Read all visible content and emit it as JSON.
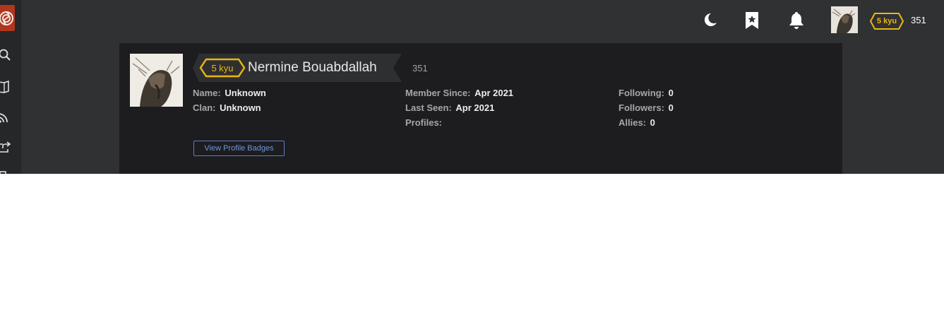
{
  "sidebar": {
    "logo_icon": "codewars-logo-icon",
    "items": [
      {
        "icon": "search-icon"
      },
      {
        "icon": "book-icon"
      },
      {
        "icon": "rss-icon"
      },
      {
        "icon": "share-icon"
      }
    ]
  },
  "topbar": {
    "theme_icon": "moon-icon",
    "bookmark_icon": "bookmark-star-icon",
    "notifications_icon": "bell-icon",
    "rank": "5 kyu",
    "honor": "351"
  },
  "profile": {
    "rank": "5 kyu",
    "username": "Nermine Bouabdallah",
    "honor": "351",
    "stats": {
      "col1": [
        {
          "label": "Name:",
          "value": "Unknown"
        },
        {
          "label": "Clan:",
          "value": "Unknown"
        }
      ],
      "col2": [
        {
          "label": "Member Since:",
          "value": "Apr 2021"
        },
        {
          "label": "Last Seen:",
          "value": "Apr 2021"
        },
        {
          "label": "Profiles:",
          "value": ""
        }
      ],
      "col3": [
        {
          "label": "Following:",
          "value": "0"
        },
        {
          "label": "Followers:",
          "value": "0"
        },
        {
          "label": "Allies:",
          "value": "0"
        }
      ]
    },
    "badges_button": "View Profile Badges"
  },
  "colors": {
    "background": "#303133",
    "card": "#1d1d1f",
    "rank_yellow": "#ecb613",
    "brand_red": "#b1361e",
    "link_blue": "#6d95dd"
  }
}
